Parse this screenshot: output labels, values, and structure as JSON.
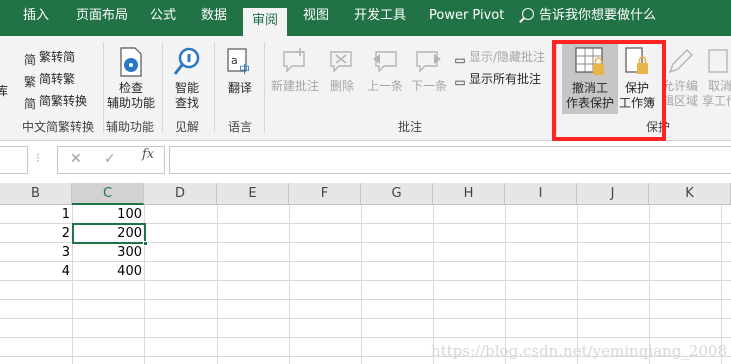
{
  "tabs": [
    "插入",
    "页面布局",
    "公式",
    "数据",
    "审阅",
    "视图",
    "开发工具",
    "Power Pivot"
  ],
  "tell_me": "告诉我你想要做什么",
  "ribbon": {
    "cut_label": "库",
    "chinese_convert": {
      "to_traditional": "繁转简",
      "to_simplified": "简转繁",
      "convert": "简繁转换",
      "group": "中文简繁转换"
    },
    "accessibility": {
      "label1": "检查",
      "label2": "辅助功能",
      "group": "辅助功能"
    },
    "insights": {
      "label1": "智能",
      "label2": "查找",
      "group": "见解"
    },
    "language": {
      "label": "翻译",
      "group": "语言"
    },
    "comments": {
      "new": "新建批注",
      "delete": "删除",
      "prev": "上一条",
      "next": "下一条",
      "show_hide": "显示/隐藏批注",
      "show_all": "显示所有批注",
      "group": "批注"
    },
    "protect": {
      "unprotect1": "撤消工",
      "unprotect2": "作表保护",
      "workbook1": "保护",
      "workbook2": "工作簿",
      "allow1": "允许编",
      "allow2": "辑区域",
      "unshare1": "取消",
      "unshare2": "享工作",
      "group": "保护"
    }
  },
  "formula_bar": {
    "cancel": "✕",
    "enter": "✓",
    "fx": "fx",
    "value": ""
  },
  "columns": [
    "B",
    "C",
    "D",
    "E",
    "F",
    "G",
    "H",
    "I",
    "J",
    "K"
  ],
  "active_column": "C",
  "cells": [
    {
      "b": "1",
      "c": "100"
    },
    {
      "b": "2",
      "c": "200"
    },
    {
      "b": "3",
      "c": "300"
    },
    {
      "b": "4",
      "c": "400"
    }
  ],
  "watermark": "https://blog.csdn.net/yeminqiang_2008",
  "colors": {
    "accent": "#217346",
    "highlight": "#ff2323"
  }
}
